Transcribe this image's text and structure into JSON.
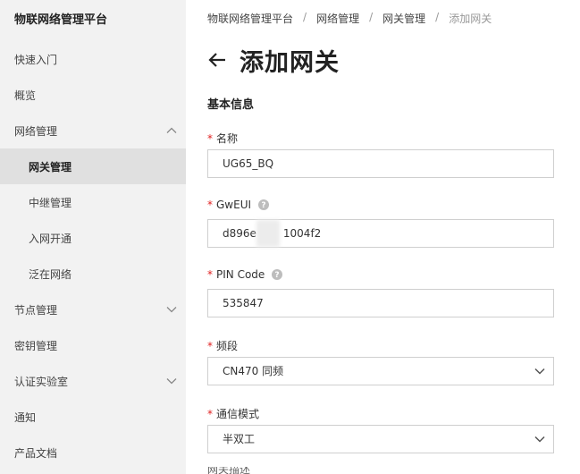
{
  "app": {
    "title": "物联网络管理平台"
  },
  "sidebar": {
    "items": [
      {
        "label": "快速入门"
      },
      {
        "label": "概览"
      },
      {
        "label": "网络管理"
      },
      {
        "label": "网关管理"
      },
      {
        "label": "中继管理"
      },
      {
        "label": "入网开通"
      },
      {
        "label": "泛在网络"
      },
      {
        "label": "节点管理"
      },
      {
        "label": "密钥管理"
      },
      {
        "label": "认证实验室"
      },
      {
        "label": "通知"
      },
      {
        "label": "产品文档"
      }
    ]
  },
  "breadcrumb": [
    "物联网络管理平台",
    "网络管理",
    "网关管理",
    "添加网关"
  ],
  "page": {
    "title": "添加网关",
    "section": "基本信息"
  },
  "form": {
    "required_mark": "*",
    "name": {
      "label": "名称",
      "value": "UG65_BQ"
    },
    "gweui": {
      "label": "GwEUI",
      "value_prefix": "d896e",
      "value_suffix": "1004f2"
    },
    "pin": {
      "label": "PIN Code",
      "value": "535847"
    },
    "band": {
      "label": "频段",
      "value": "CN470 同频"
    },
    "mode": {
      "label": "通信模式",
      "value": "半双工"
    },
    "next_label_cut": "网关描述"
  },
  "colors": {
    "required": "#e02020",
    "sidebar_bg": "#f2f2f2",
    "active_bg": "#e0e0e0"
  },
  "icons": {
    "back": "arrow-left-icon",
    "help": "question-circle-icon",
    "expand": "chevron-down-icon",
    "collapse": "chevron-up-icon"
  }
}
